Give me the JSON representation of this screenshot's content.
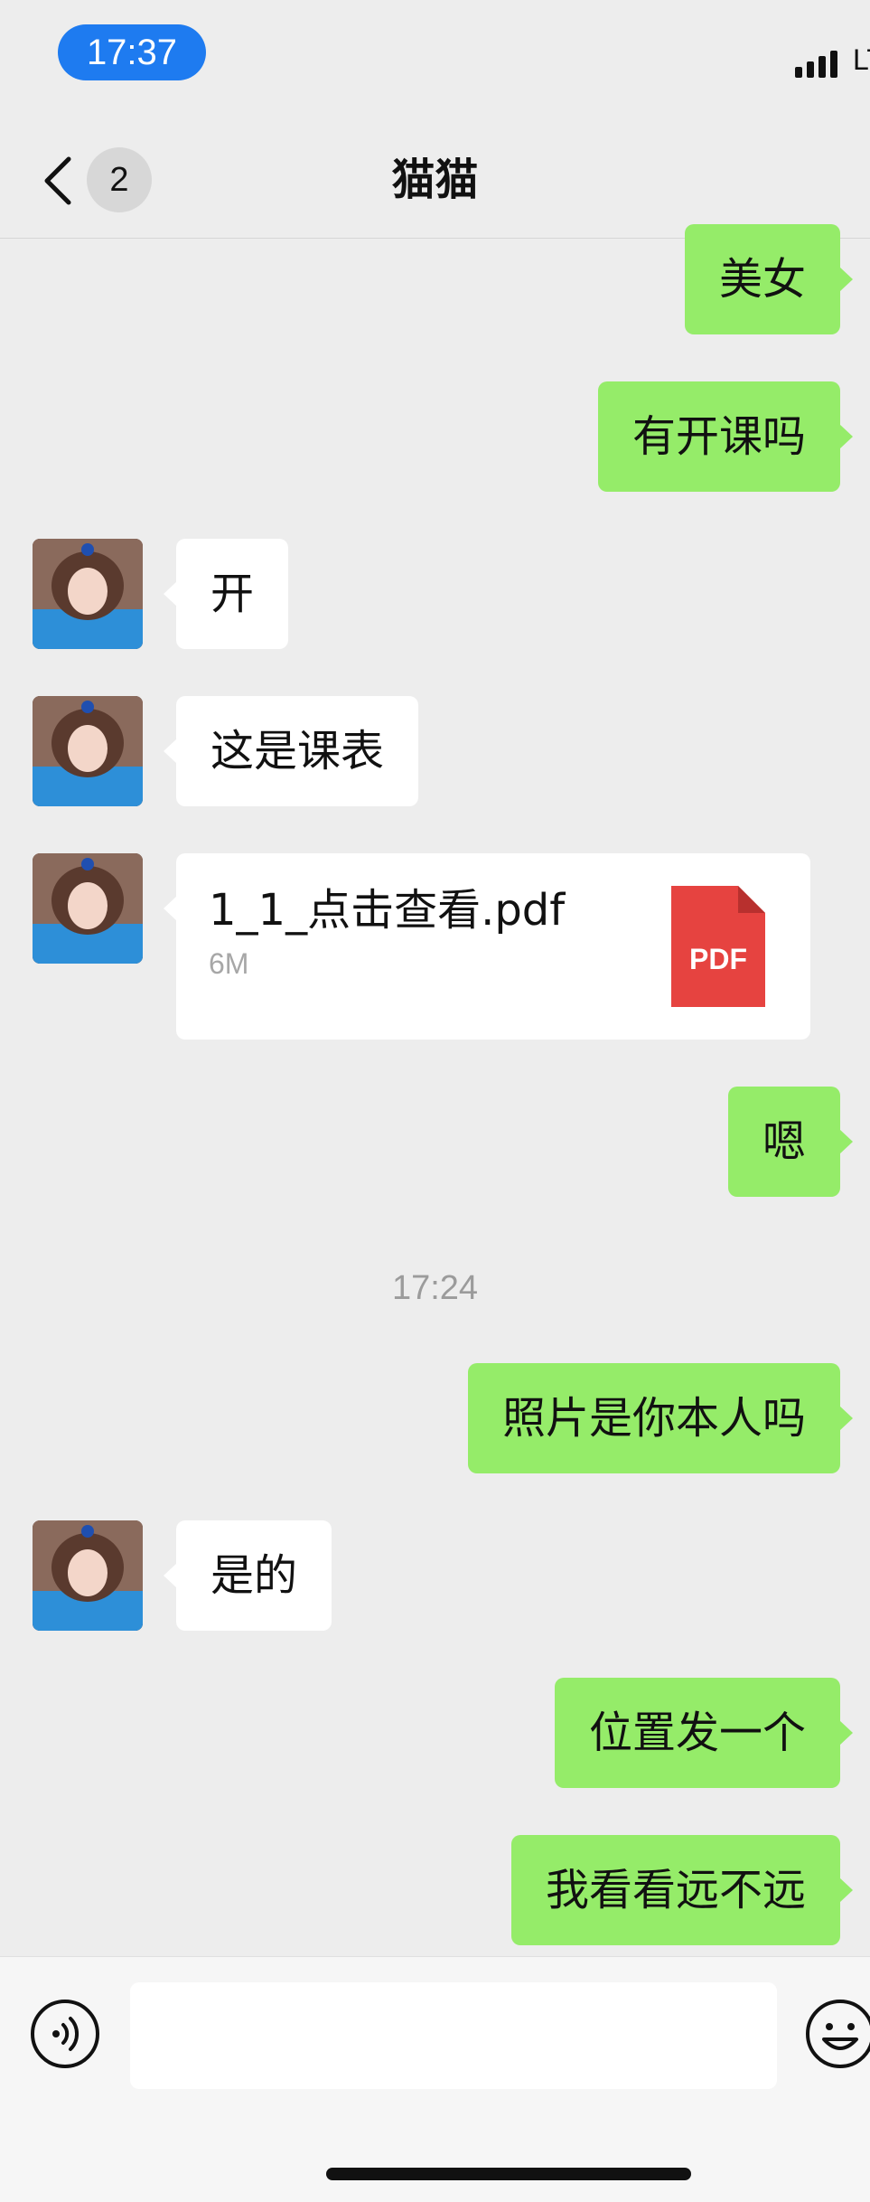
{
  "status_bar": {
    "time": "17:37",
    "network": "LT"
  },
  "header": {
    "back_label": "back",
    "unread_count": "2",
    "title": "猫猫"
  },
  "messages": [
    {
      "side": "out",
      "text": "美女"
    },
    {
      "side": "out",
      "text": "有开课吗"
    },
    {
      "side": "in",
      "text": "开"
    },
    {
      "side": "in",
      "text": "这是课表"
    },
    {
      "side": "in",
      "type": "file",
      "file_name": "1_1_点击查看.pdf",
      "file_size": "6M",
      "file_badge": "PDF"
    },
    {
      "side": "out",
      "text": "嗯"
    },
    {
      "type": "time",
      "text": "17:24"
    },
    {
      "side": "out",
      "text": "照片是你本人吗"
    },
    {
      "side": "in",
      "text": "是的"
    },
    {
      "side": "out",
      "text": "位置发一个"
    },
    {
      "side": "out",
      "text": "我看看远不远"
    }
  ],
  "input_bar": {
    "placeholder": "",
    "voice_icon": "voice-icon",
    "emoji_icon": "emoji-icon"
  },
  "colors": {
    "outgoing_bubble": "#95ec69",
    "incoming_bubble": "#ffffff",
    "background": "#ededed",
    "status_pill": "#1e7bf0",
    "pdf_red": "#e64340"
  }
}
